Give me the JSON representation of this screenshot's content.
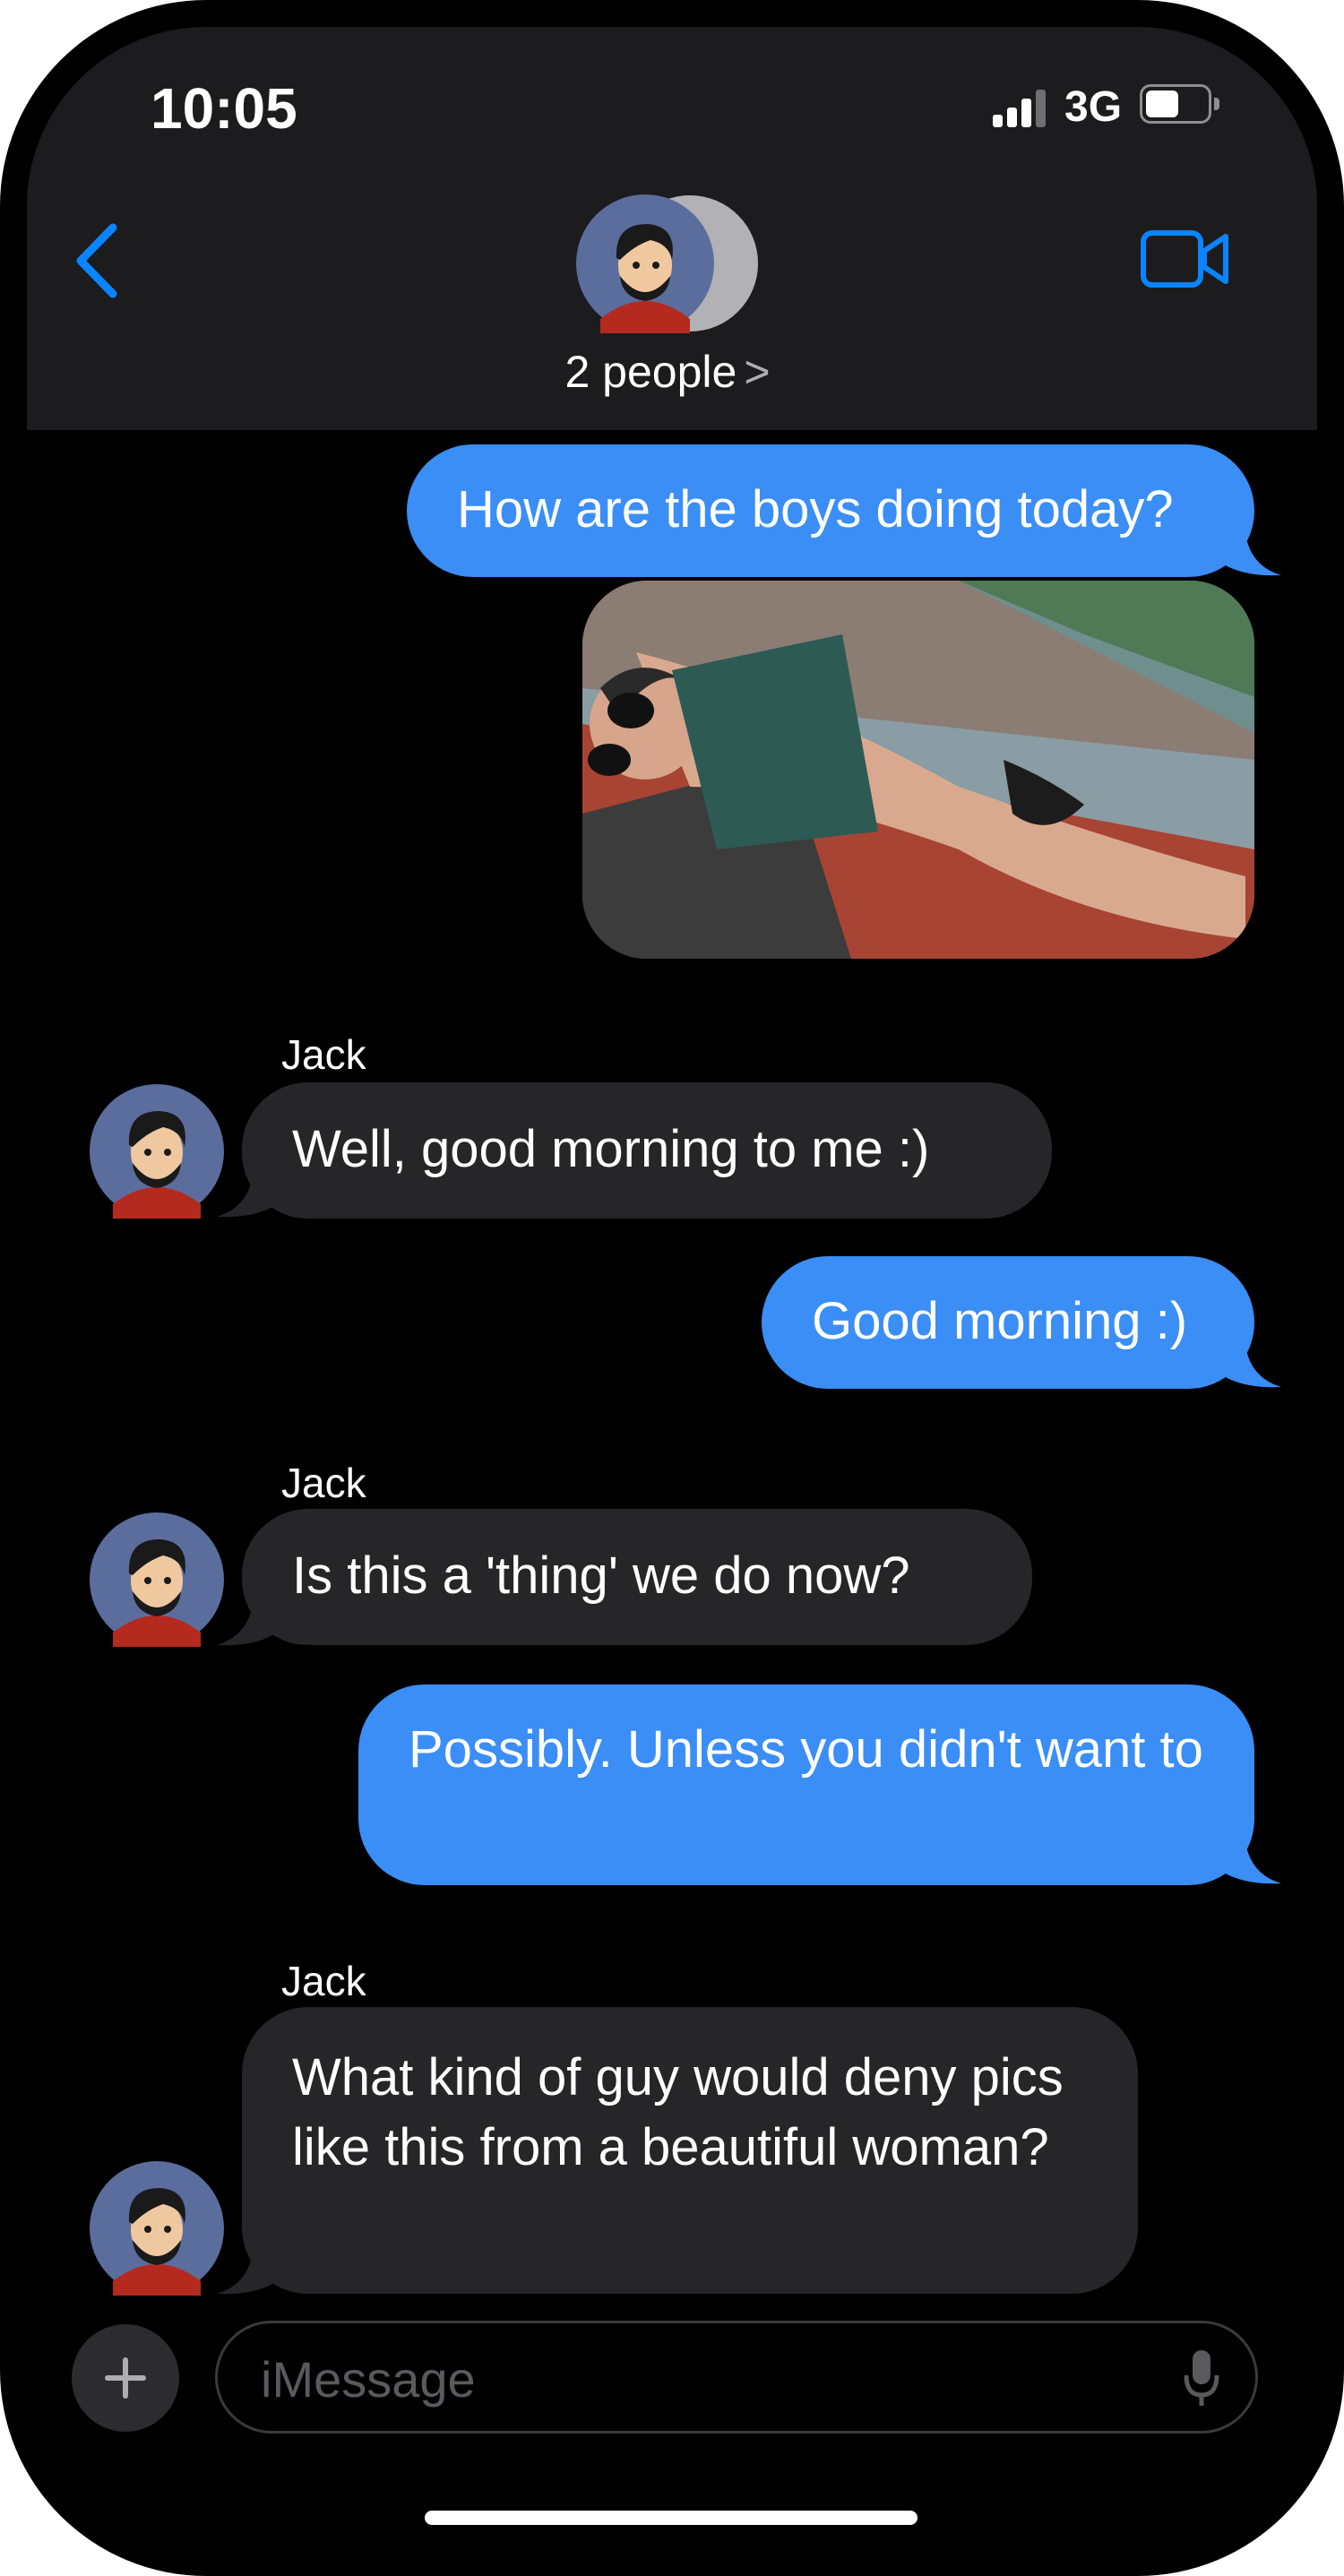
{
  "status_bar": {
    "time": "10:05",
    "network": "3G"
  },
  "header": {
    "group_label": "2 people",
    "chevron": ">"
  },
  "messages": [
    {
      "side": "out",
      "text": "How are the boys doing today?"
    },
    {
      "side": "out",
      "type": "image",
      "description": "photo attachment"
    },
    {
      "side": "in",
      "sender": "Jack",
      "text": "Well, good morning to me :)"
    },
    {
      "side": "out",
      "text": "Good morning :)"
    },
    {
      "side": "in",
      "sender": "Jack",
      "text": "Is this a 'thing' we do now?"
    },
    {
      "side": "out",
      "text": "Possibly. Unless you didn't want to"
    },
    {
      "side": "in",
      "sender": "Jack",
      "text": "What kind of guy would deny pics like this from a beautiful woman?"
    }
  ],
  "composer": {
    "placeholder": "iMessage"
  },
  "colors": {
    "outgoing": "#3a8ef6",
    "incoming": "#262629",
    "accent": "#0a84ff"
  },
  "icons": [
    "back-chevron-icon",
    "video-call-icon",
    "plus-icon",
    "microphone-icon"
  ]
}
